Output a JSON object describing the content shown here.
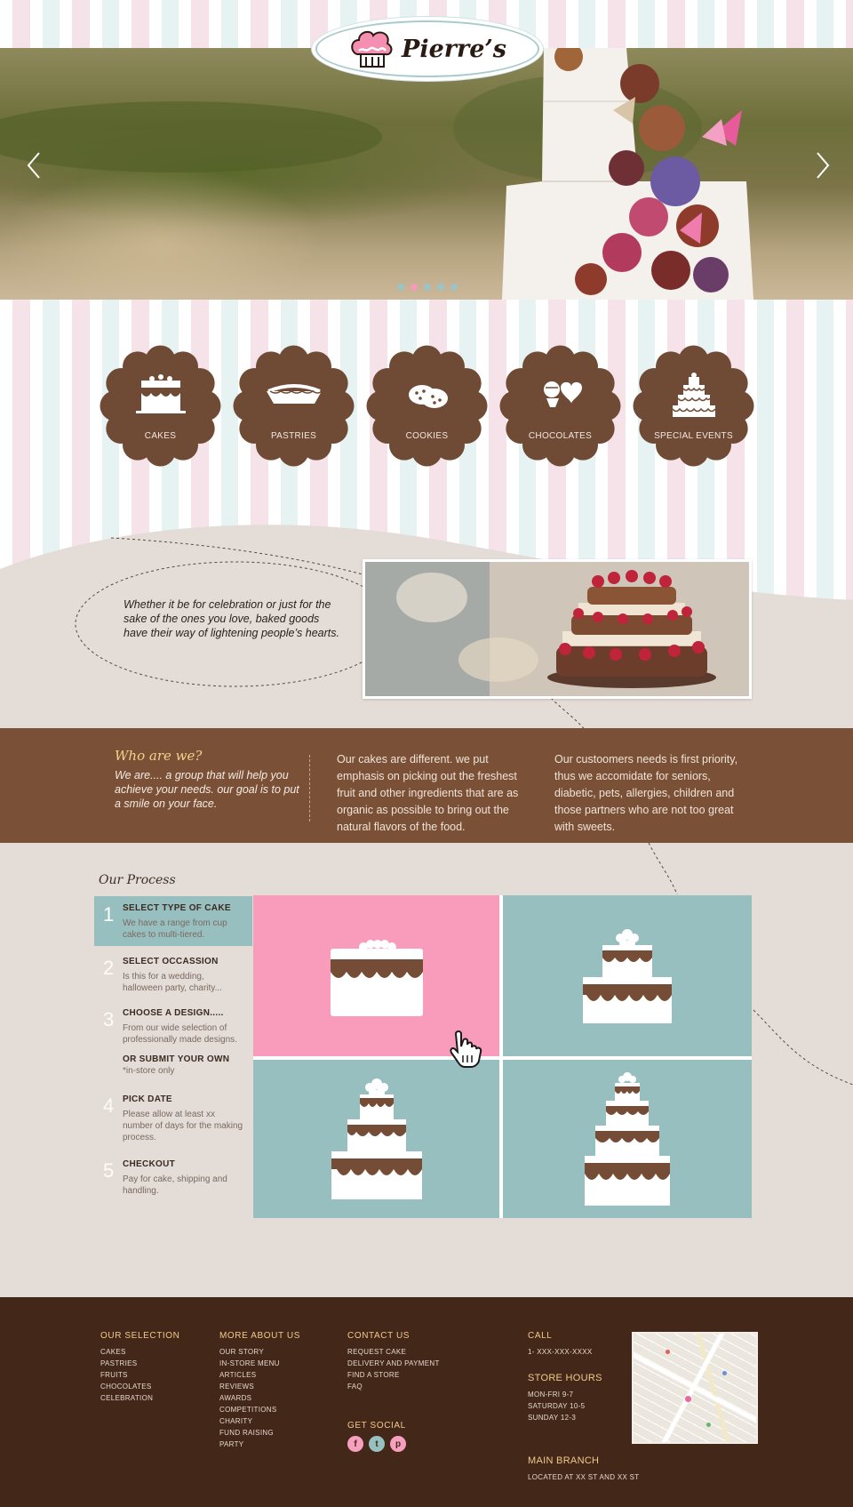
{
  "brand": {
    "name": "Pierre’s"
  },
  "hero": {
    "prev_icon": "chevron-left-icon",
    "next_icon": "chevron-right-icon",
    "slides": 5,
    "active_slide": 2
  },
  "categories": [
    {
      "label": "CAKES",
      "icon": "cake-icon"
    },
    {
      "label": "PASTRIES",
      "icon": "pie-icon"
    },
    {
      "label": "COOKIES",
      "icon": "cookies-icon"
    },
    {
      "label": "CHOCOLATES",
      "icon": "chocolates-icon"
    },
    {
      "label": "SPECIAL EVENTS",
      "icon": "tiered-cake-icon"
    }
  ],
  "intro": {
    "quote": "Whether it be for celebration or just for the sake of the ones you love, baked goods have their way of lightening people’s hearts."
  },
  "about": {
    "title": "Who are we?",
    "lead": "We are.... a group that will help you achieve your needs. our goal is to put a smile on your face.",
    "col1": "Our cakes are different. we put emphasis on picking out the freshest fruit and other ingredients that are as organic as possible to bring out the natural flavors of the food.",
    "col2": "Our custoomers needs is first priority, thus we accomidate for seniors, diabetic, pets, allergies, children and those partners who are not too great with sweets."
  },
  "process": {
    "title": "Our Process",
    "steps": [
      {
        "num": "1",
        "title": "SELECT TYPE OF CAKE",
        "desc": "We have a range from cup cakes to multi-tiered."
      },
      {
        "num": "2",
        "title": "SELECT OCCASSION",
        "desc": "Is this for a wedding, halloween party, charity..."
      },
      {
        "num": "3",
        "title": "CHOOSE A DESIGN.....",
        "desc": "From our wide selection of professionally made designs."
      },
      {
        "num": "4",
        "title": "PICK DATE",
        "desc": "Please allow at least xx number of days for the making process."
      },
      {
        "num": "5",
        "title": "CHECKOUT",
        "desc": "Pay for cake, shipping and handling."
      }
    ],
    "alt": {
      "title": "OR SUBMIT YOUR OWN",
      "desc": "*in-store only"
    },
    "tiles": [
      {
        "icon": "single-tier-cake-icon",
        "color": "#f99cbb"
      },
      {
        "icon": "two-tier-cake-icon",
        "color": "#98bfbf"
      },
      {
        "icon": "three-tier-cake-icon",
        "color": "#98bfbf"
      },
      {
        "icon": "four-tier-cake-icon",
        "color": "#98bfbf"
      }
    ]
  },
  "footer": {
    "selection": {
      "heading": "OUR SELECTION",
      "links": [
        "CAKES",
        "PASTRIES",
        "FRUITS",
        "CHOCOLATES",
        "CELEBRATION"
      ]
    },
    "more": {
      "heading": "MORE ABOUT US",
      "links": [
        "OUR STORY",
        "IN-STORE MENU",
        "ARTICLES",
        "REVIEWS",
        "AWARDS",
        "COMPETITIONS",
        "CHARITY",
        "FUND RAISING",
        "PARTY"
      ]
    },
    "contact": {
      "heading": "CONTACT US",
      "links": [
        "REQUEST CAKE",
        "DELIVERY AND PAYMENT",
        "FIND A STORE",
        "FAQ"
      ]
    },
    "social": {
      "heading": "GET SOCIAL",
      "icons": [
        {
          "name": "facebook-icon",
          "glyph": "f",
          "color": "#f79fbe"
        },
        {
          "name": "twitter-icon",
          "glyph": "t",
          "color": "#97c0c1"
        },
        {
          "name": "pinterest-icon",
          "glyph": "p",
          "color": "#f79fbe"
        }
      ]
    },
    "call": {
      "heading": "CALL",
      "phone": "1- XXX-XXX-XXXX"
    },
    "hours": {
      "heading": "STORE HOURS",
      "lines": [
        "MON-FRI  9-7",
        "SATURDAY 10-5",
        "SUNDAY 12-3"
      ]
    },
    "branch": {
      "heading": "MAIN BRANCH",
      "address": "LOCATED AT XX ST AND XX ST"
    }
  },
  "colors": {
    "brown": "#7a5137",
    "dark_brown": "#432719",
    "pink": "#f99cbb",
    "teal": "#98bfbf",
    "gold": "#f2c98b"
  }
}
